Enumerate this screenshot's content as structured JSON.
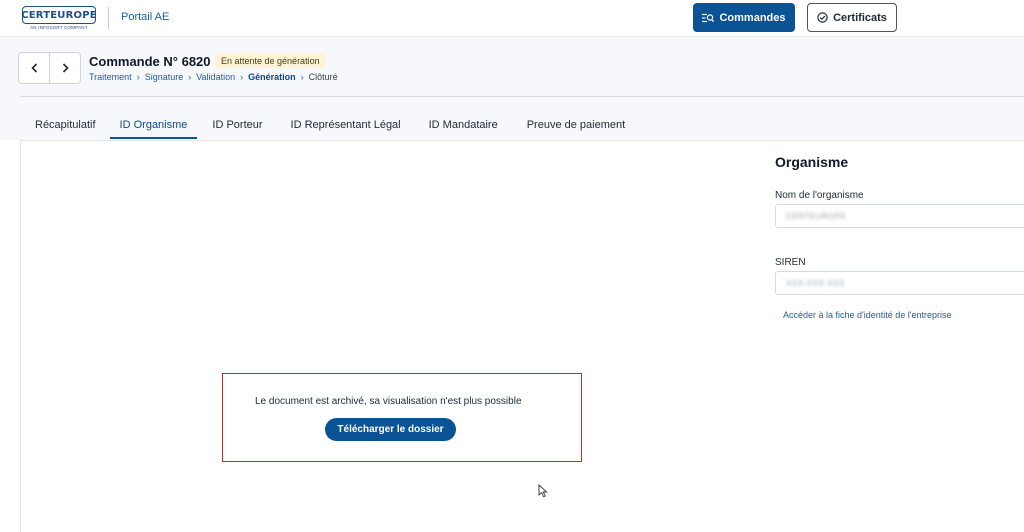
{
  "header": {
    "logo_text": "CERTEUROPE",
    "logo_subtext": "AN INFOCERT COMPANY",
    "app_name": "Portail AE",
    "commandes_label": "Commandes",
    "certificats_label": "Certificats"
  },
  "order": {
    "title": "Commande N° 6820",
    "status": "En attente de génération",
    "breadcrumb": [
      "Traitement",
      "Signature",
      "Validation",
      "Génération",
      "Clôturé"
    ],
    "breadcrumb_active_index": 3
  },
  "tabs": [
    {
      "label": "Récapitulatif",
      "active": false
    },
    {
      "label": "ID Organisme",
      "active": true
    },
    {
      "label": "ID Porteur",
      "active": false
    },
    {
      "label": "ID Représentant Légal",
      "active": false
    },
    {
      "label": "ID Mandataire",
      "active": false
    },
    {
      "label": "Preuve de paiement",
      "active": false
    }
  ],
  "viewer": {
    "message": "Le document est archivé, sa visualisation n'est plus possible",
    "download_label": "Télécharger le dossier"
  },
  "organisme": {
    "title": "Organisme",
    "name_label": "Nom de l'organisme",
    "name_value": "CERTEUROPE",
    "siren_label": "SIREN",
    "siren_value": "XXX-XXX-XXX",
    "link_label": "Accéder à la fiche d'identité de l'entreprise"
  },
  "colors": {
    "primary": "#0b5394",
    "link": "#1f5fa6",
    "badge_bg": "#fdf3d7",
    "highlight_border": "#c92a2a"
  }
}
